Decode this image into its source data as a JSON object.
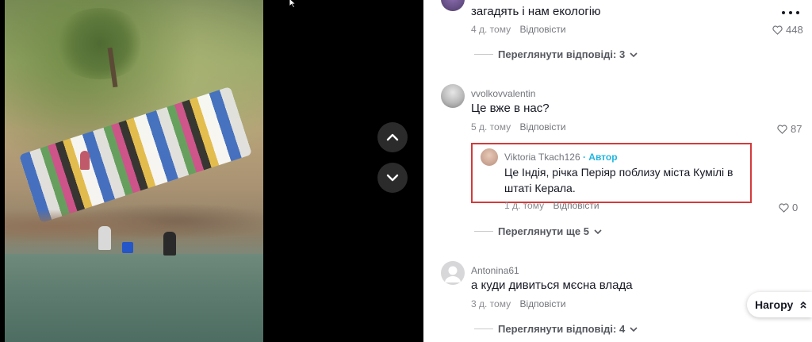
{
  "comments": [
    {
      "text": "загадять і нам екологію",
      "time": "4 д. тому",
      "reply_label": "Відповісти",
      "likes": "448",
      "view_replies": "Переглянути відповіді: 3"
    },
    {
      "username": "vvolkovvalentin",
      "text": "Це вже в нас?",
      "time": "5 д. тому",
      "reply_label": "Відповісти",
      "likes": "87",
      "reply": {
        "username": "Viktoria Tkach126",
        "author_tag": "· Автор",
        "text_line1": "Це Індія, річка Періяр поблизу міста Кумілі в",
        "text_line2": "штаті Керала.",
        "time": "1 д. тому",
        "reply_label": "Відповісти",
        "likes": "0"
      },
      "view_more": "Переглянути ще 5"
    },
    {
      "username": "Antonina61",
      "text": "а куди дивиться мєсна влада",
      "time": "3 д. тому",
      "reply_label": "Відповісти",
      "view_replies": "Переглянути відповіді: 4"
    }
  ],
  "back_to_top": "Нагору",
  "icons": {
    "nav_up": "chevron-up-icon",
    "nav_down": "chevron-down-icon",
    "like": "heart-icon",
    "more": "more-dots-icon"
  },
  "colors": {
    "author_tag": "#20b5e0",
    "highlight_box": "#d43a3a"
  }
}
